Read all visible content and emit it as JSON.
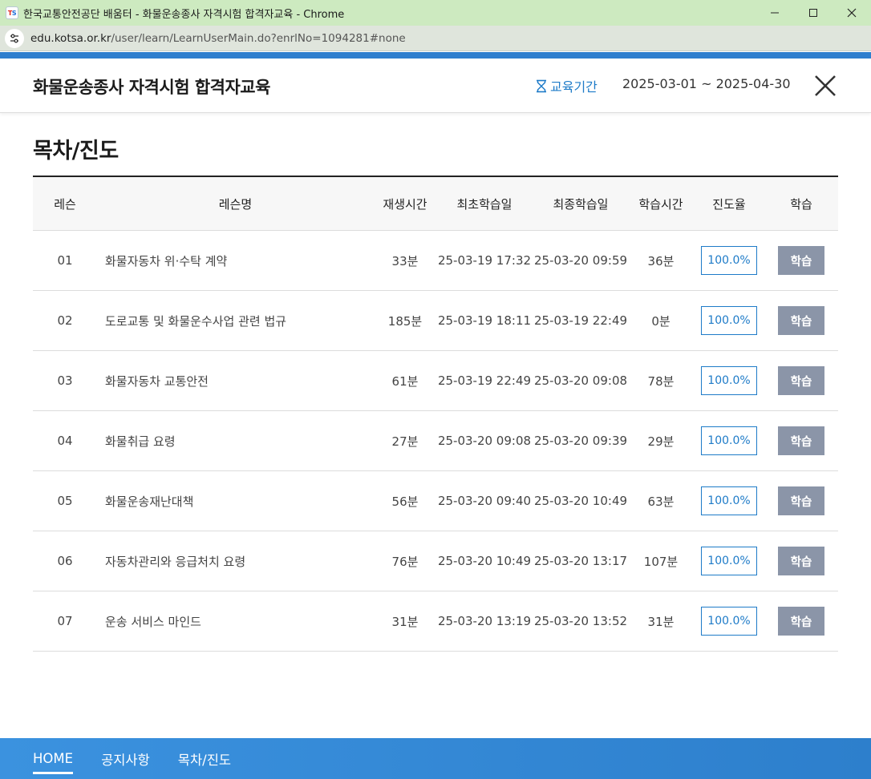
{
  "browser": {
    "window_title": "한국교통안전공단 배움터 - 화물운송종사 자격시험 합격자교육 - Chrome",
    "url_host": "edu.kotsa.or.kr",
    "url_path": "/user/learn/LearnUserMain.do?enrlNo=1094281#none",
    "favicon_text_t": "T",
    "favicon_text_s": "S"
  },
  "header": {
    "course_title": "화물운송종사 자격시험 합격자교육",
    "period_label": "교육기간",
    "period_dates": "2025-03-01 ~ 2025-04-30"
  },
  "section": {
    "title": "목차/진도"
  },
  "table": {
    "headers": {
      "lesson": "레슨",
      "lesson_name": "레슨명",
      "play_time": "재생시간",
      "first_date": "최초학습일",
      "last_date": "최종학습일",
      "study_time": "학습시간",
      "progress": "진도율",
      "study": "학습"
    },
    "rows": [
      {
        "no": "01",
        "name": "화물자동차 위·수탁 계약",
        "play": "33분",
        "first": "25-03-19 17:32",
        "last": "25-03-20 09:59",
        "time": "36분",
        "progress": "100.0%",
        "button": "학습"
      },
      {
        "no": "02",
        "name": "도로교통 및 화물운수사업 관련 법규",
        "play": "185분",
        "first": "25-03-19 18:11",
        "last": "25-03-19 22:49",
        "time": "0분",
        "progress": "100.0%",
        "button": "학습"
      },
      {
        "no": "03",
        "name": "화물자동차 교통안전",
        "play": "61분",
        "first": "25-03-19 22:49",
        "last": "25-03-20 09:08",
        "time": "78분",
        "progress": "100.0%",
        "button": "학습"
      },
      {
        "no": "04",
        "name": "화물취급 요령",
        "play": "27분",
        "first": "25-03-20 09:08",
        "last": "25-03-20 09:39",
        "time": "29분",
        "progress": "100.0%",
        "button": "학습"
      },
      {
        "no": "05",
        "name": "화물운송재난대책",
        "play": "56분",
        "first": "25-03-20 09:40",
        "last": "25-03-20 10:49",
        "time": "63분",
        "progress": "100.0%",
        "button": "학습"
      },
      {
        "no": "06",
        "name": "자동차관리와 응급처치 요령",
        "play": "76분",
        "first": "25-03-20 10:49",
        "last": "25-03-20 13:17",
        "time": "107분",
        "progress": "100.0%",
        "button": "학습"
      },
      {
        "no": "07",
        "name": "운송 서비스 마인드",
        "play": "31분",
        "first": "25-03-20 13:19",
        "last": "25-03-20 13:52",
        "time": "31분",
        "progress": "100.0%",
        "button": "학습"
      }
    ]
  },
  "bottom_nav": {
    "items": [
      "HOME",
      "공지사항",
      "목차/진도"
    ],
    "active": "HOME"
  },
  "colors": {
    "accent_blue": "#2f7fce",
    "progress_blue": "#1e7bc8",
    "study_button": "#8b95a8",
    "titlebar_green": "#cdeac0"
  },
  "icons": {
    "period": "hourglass-icon",
    "close": "close-icon",
    "site_info": "tune-icon"
  }
}
